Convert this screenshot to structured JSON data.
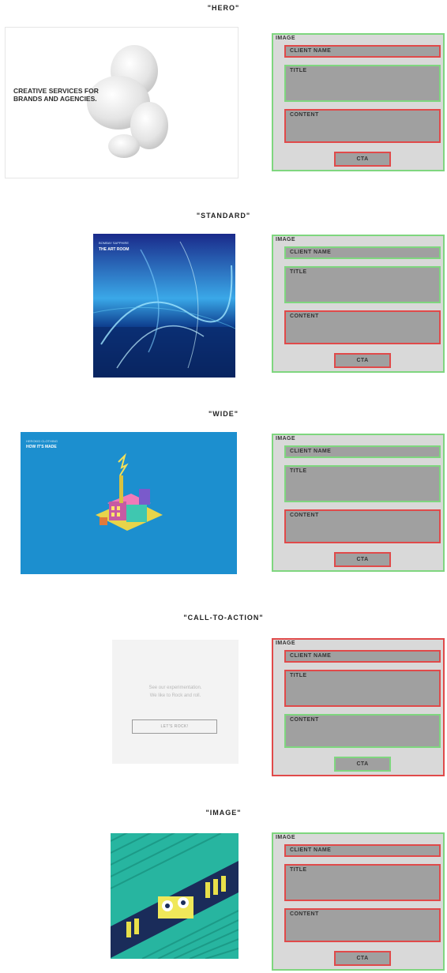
{
  "sections": [
    {
      "heading": "\"HERO\"",
      "preview_text": "CREATIVE SERVICES FOR\nBRANDS AND AGENCIES.",
      "panel": {
        "image": "IMAGE",
        "client_name": "CLIENT NAME",
        "title": "TITLE",
        "content": "CONTENT",
        "cta": "CTA"
      },
      "status": {
        "image": "green",
        "client_name": "red",
        "title": "green",
        "content": "red",
        "cta": "red"
      }
    },
    {
      "heading": "\"STANDARD\"",
      "preview_line1": "BOMBAY SAPPHIRE",
      "preview_line2": "THE ART ROOM",
      "panel": {
        "image": "IMAGE",
        "client_name": "CLIENT NAME",
        "title": "TITLE",
        "content": "CONTENT",
        "cta": "CTA"
      },
      "status": {
        "image": "green",
        "client_name": "green",
        "title": "green",
        "content": "red",
        "cta": "red"
      }
    },
    {
      "heading": "\"WIDE\"",
      "preview_line1": "HEROKID CLOTHING",
      "preview_line2": "HOW IT'S MADE",
      "panel": {
        "image": "IMAGE",
        "client_name": "CLIENT NAME",
        "title": "TITLE",
        "content": "CONTENT",
        "cta": "CTA"
      },
      "status": {
        "image": "green",
        "client_name": "green",
        "title": "green",
        "content": "red",
        "cta": "red"
      }
    },
    {
      "heading": "\"CALL-TO-ACTION\"",
      "preview_line1": "See our experimentation.",
      "preview_line2": "We like to Rock and roll.",
      "preview_button": "LET'S ROCK!",
      "panel": {
        "image": "IMAGE",
        "client_name": "CLIENT NAME",
        "title": "TITLE",
        "content": "CONTENT",
        "cta": "CTA"
      },
      "status": {
        "image": "red",
        "client_name": "red",
        "title": "red",
        "content": "green",
        "cta": "green"
      }
    },
    {
      "heading": "\"IMAGE\"",
      "panel": {
        "image": "IMAGE",
        "client_name": "CLIENT NAME",
        "title": "TITLE",
        "content": "CONTENT",
        "cta": "CTA"
      },
      "status": {
        "image": "green",
        "client_name": "red",
        "title": "red",
        "content": "red",
        "cta": "red"
      }
    }
  ],
  "colors": {
    "used": "#7fd67f",
    "unused": "#e04a4a",
    "panel_bg": "#d9d9d9",
    "slot_bg": "#a0a0a0"
  }
}
